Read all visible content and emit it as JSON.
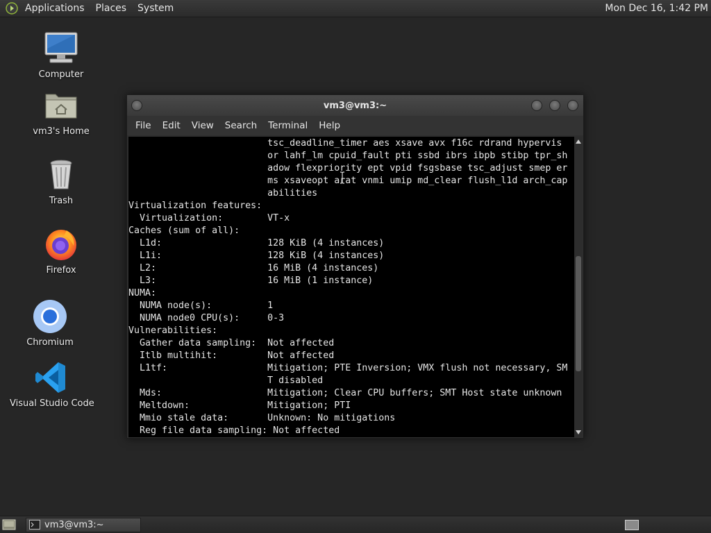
{
  "top_panel": {
    "menus": [
      "Applications",
      "Places",
      "System"
    ],
    "clock": "Mon Dec 16,  1:42 PM"
  },
  "desktop": {
    "icons": [
      {
        "label": "Computer",
        "icon": "computer-icon"
      },
      {
        "label": "vm3's Home",
        "icon": "home-folder-icon"
      },
      {
        "label": "Trash",
        "icon": "trash-icon"
      },
      {
        "label": "Firefox",
        "icon": "firefox-icon"
      },
      {
        "label": "Chromium",
        "icon": "chromium-icon"
      },
      {
        "label": "Visual Studio Code",
        "icon": "vscode-icon"
      }
    ]
  },
  "window": {
    "title": "vm3@vm3:~",
    "menu": [
      "File",
      "Edit",
      "View",
      "Search",
      "Terminal",
      "Help"
    ]
  },
  "terminal": {
    "lines": [
      "                         tsc_deadline_timer aes xsave avx f16c rdrand hypervis",
      "                         or lahf_lm cpuid_fault pti ssbd ibrs ibpb stibp tpr_sh",
      "                         adow flexpriority ept vpid fsgsbase tsc_adjust smep er",
      "                         ms xsaveopt arat vnmi umip md_clear flush_l1d arch_cap",
      "                         abilities",
      "Virtualization features:",
      "  Virtualization:        VT-x",
      "Caches (sum of all):",
      "  L1d:                   128 KiB (4 instances)",
      "  L1i:                   128 KiB (4 instances)",
      "  L2:                    16 MiB (4 instances)",
      "  L3:                    16 MiB (1 instance)",
      "NUMA:",
      "  NUMA node(s):          1",
      "  NUMA node0 CPU(s):     0-3",
      "Vulnerabilities:",
      "  Gather data sampling:  Not affected",
      "  Itlb multihit:         Not affected",
      "  L1tf:                  Mitigation; PTE Inversion; VMX flush not necessary, SM",
      "                         T disabled",
      "  Mds:                   Mitigation; Clear CPU buffers; SMT Host state unknown",
      "  Meltdown:              Mitigation; PTI",
      "  Mmio stale data:       Unknown: No mitigations",
      "  Reg file data sampling: Not affected"
    ]
  },
  "taskbar": {
    "tasks": [
      {
        "label": "vm3@vm3:~",
        "icon": "terminal-icon"
      }
    ]
  },
  "colors": {
    "desktop_bg": "#262626",
    "terminal_bg": "#000000",
    "terminal_fg": "#e6e6e6"
  }
}
